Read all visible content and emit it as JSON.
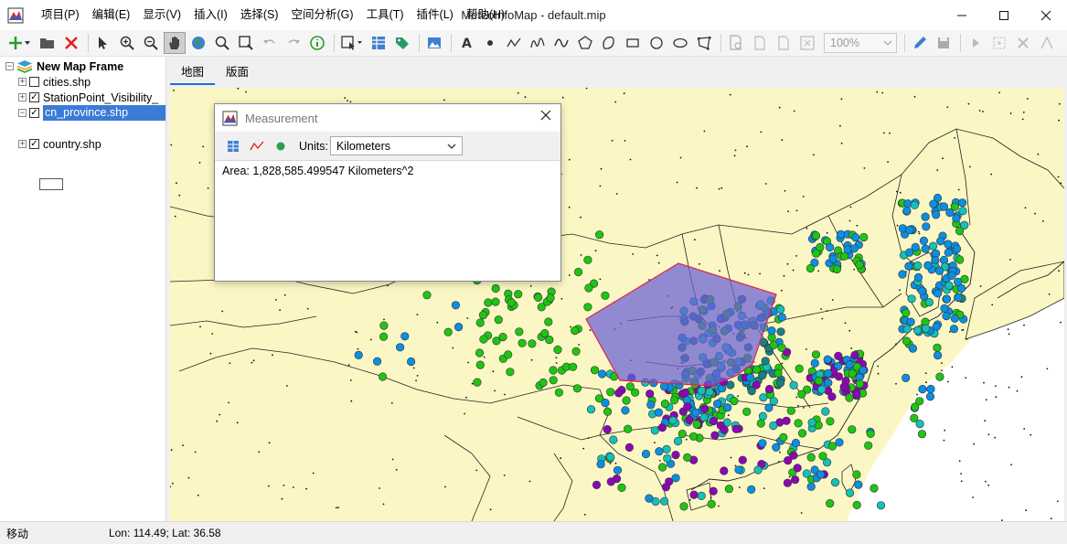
{
  "window": {
    "title": "MeteoInfoMap - default.mip"
  },
  "menu": [
    "项目(P)",
    "编辑(E)",
    "显示(V)",
    "插入(I)",
    "选择(S)",
    "空间分析(G)",
    "工具(T)",
    "插件(L)",
    "帮助(H)"
  ],
  "toolbar": {
    "zoom_value": "100%"
  },
  "layers": {
    "frame": "New Map Frame",
    "items": [
      {
        "label": "cities.shp",
        "checked": false
      },
      {
        "label": "StationPoint_Visibility_",
        "checked": true
      },
      {
        "label": "cn_province.shp",
        "checked": true,
        "selected": true
      },
      {
        "label": "country.shp",
        "checked": true
      }
    ]
  },
  "tabs": [
    "地图",
    "版面"
  ],
  "measurement": {
    "title": "Measurement",
    "units_label": "Units:",
    "units_value": "Kilometers",
    "result": "Area: 1,828,585.499547 Kilometers^2"
  },
  "status": {
    "mode": "移动",
    "coords": "Lon: 114.49; Lat: 36.58"
  },
  "colors": {
    "land": "#fbf7c4",
    "polygon": "#6a5fd6",
    "selection": "#3a7bd5",
    "accent": "#1e6fd9"
  },
  "map_features": {
    "station_colors": [
      "#0b8fe0",
      "#1fc414",
      "#14c0b8",
      "#8a07b5",
      "#1a7f83"
    ]
  }
}
